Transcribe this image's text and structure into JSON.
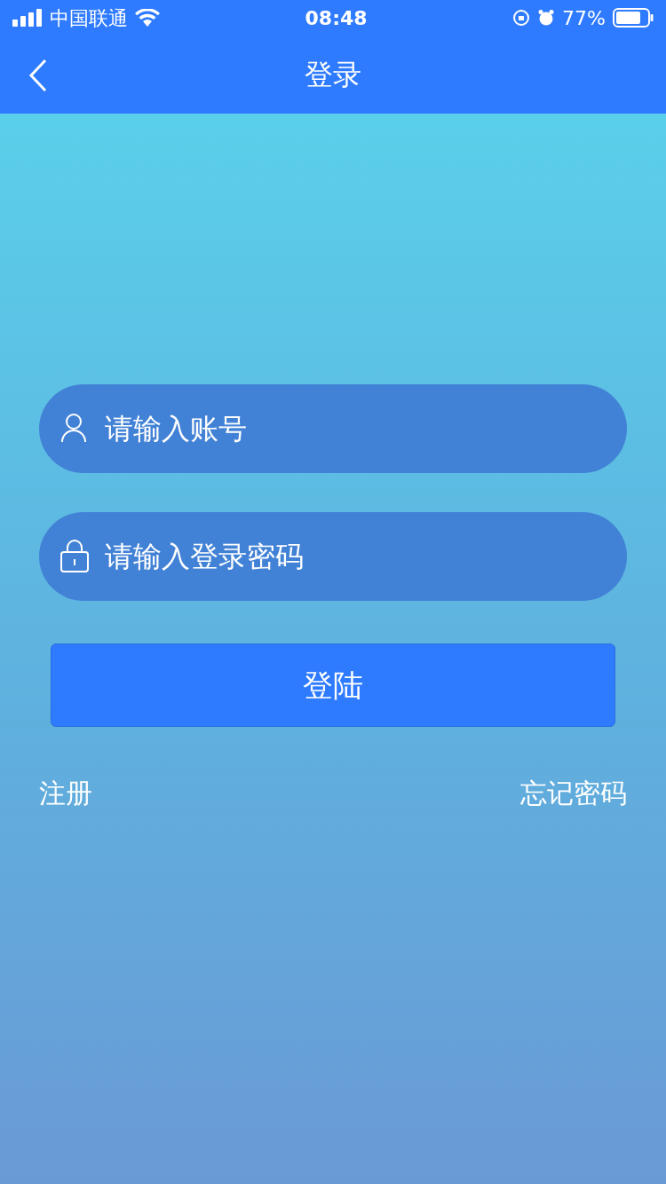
{
  "status_bar": {
    "carrier": "中国联通",
    "time": "08:48",
    "battery": "77%"
  },
  "nav": {
    "title": "登录"
  },
  "fields": [
    {
      "kind": "user",
      "placeholder": "请输入账号"
    },
    {
      "kind": "lock",
      "placeholder": "请输入登录密码"
    }
  ],
  "login_button": "登陆",
  "links": [
    "注册",
    "忘记密码"
  ]
}
